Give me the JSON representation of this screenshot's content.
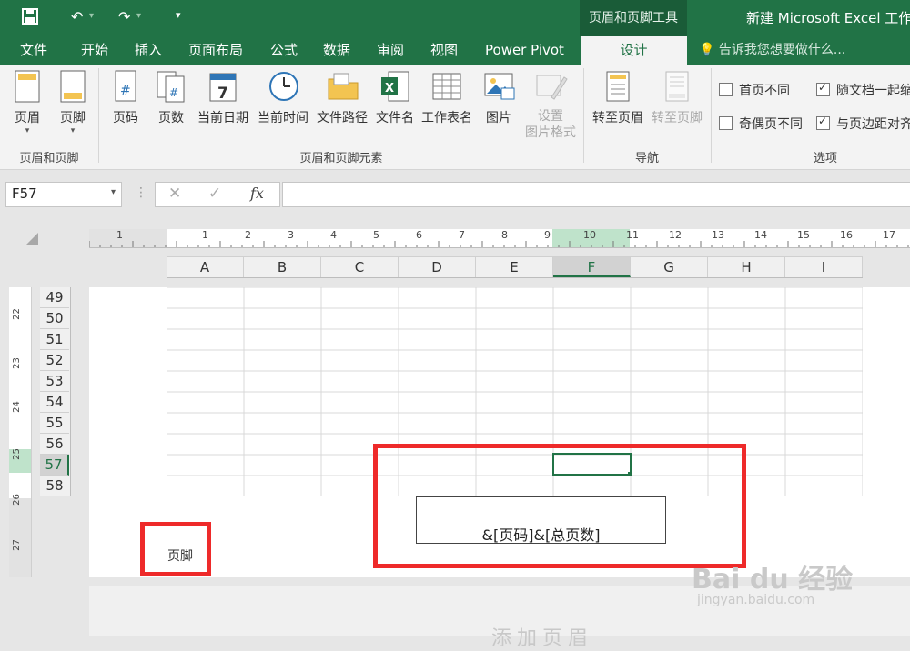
{
  "titlebar": {
    "context_group": "页眉和页脚工具",
    "window_title": "新建 Microsoft Excel 工作表"
  },
  "tabs": [
    "文件",
    "开始",
    "插入",
    "页面布局",
    "公式",
    "数据",
    "审阅",
    "视图",
    "Power Pivot",
    "设计"
  ],
  "tell_me": "告诉我您想要做什么...",
  "ribbon": {
    "group1": {
      "label": "页眉和页脚",
      "buttons": [
        "页眉",
        "页脚"
      ]
    },
    "group2": {
      "label": "页眉和页脚元素",
      "buttons": [
        "页码",
        "页数",
        "当前日期",
        "当前时间",
        "文件路径",
        "文件名",
        "工作表名",
        "图片",
        "设置",
        "图片格式"
      ]
    },
    "group3": {
      "label": "导航",
      "buttons": [
        "转至页眉",
        "转至页脚"
      ]
    },
    "group4": {
      "label": "选项",
      "options": [
        "首页不同",
        "随文档一起缩放",
        "奇偶页不同",
        "与页边距对齐"
      ]
    }
  },
  "namebox": "F57",
  "fx_label": "fx",
  "ruler_ticks": [
    "1",
    "1",
    "2",
    "3",
    "4",
    "5",
    "6",
    "7",
    "8",
    "9",
    "10",
    "11",
    "12",
    "13",
    "14",
    "15",
    "16",
    "17"
  ],
  "columns": [
    "A",
    "B",
    "C",
    "D",
    "E",
    "F",
    "G",
    "H",
    "I"
  ],
  "selected_column": "F",
  "rows": [
    "49",
    "50",
    "51",
    "52",
    "53",
    "54",
    "55",
    "56",
    "57",
    "58"
  ],
  "selected_row": "57",
  "vruler_ticks": [
    "22",
    "23",
    "24",
    "25",
    "26",
    "27"
  ],
  "footer": {
    "center_code": "&[页码]&[总页数]",
    "label": "页脚"
  },
  "next_page_hint": "添加页眉",
  "watermark": {
    "brand": "Bai du 经验",
    "url": "jingyan.baidu.com"
  },
  "colors": {
    "excel_green": "#217346",
    "highlight_red": "#ee2a2a"
  }
}
